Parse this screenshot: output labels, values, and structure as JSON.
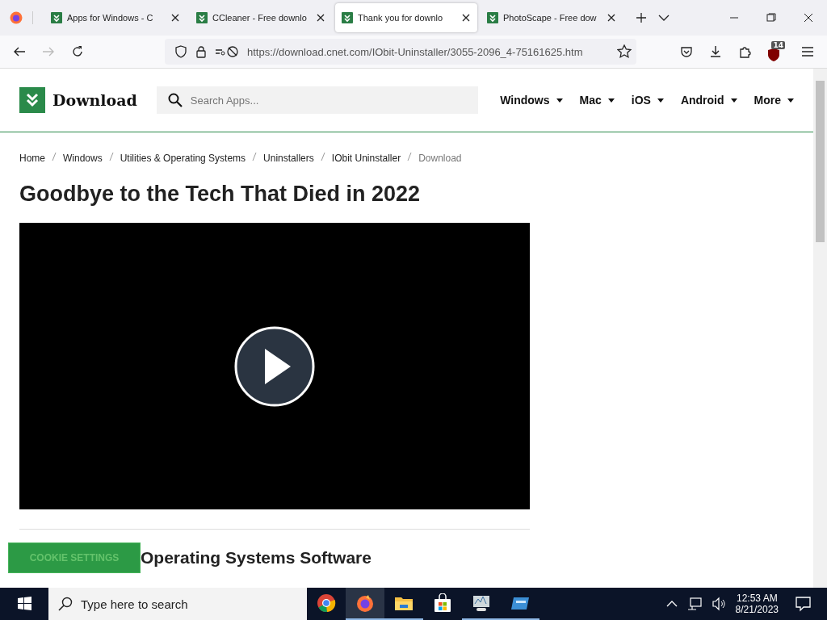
{
  "browser": {
    "tabs": [
      {
        "title": "Apps for Windows - C",
        "selected": false
      },
      {
        "title": "CCleaner - Free downlo",
        "selected": false
      },
      {
        "title": "Thank you for downlo",
        "selected": true
      },
      {
        "title": "PhotoScape - Free dow",
        "selected": false
      }
    ],
    "url": "https://download.cnet.com/IObit-Uninstaller/3055-2096_4-75161625.htm",
    "extension_badge": "14"
  },
  "site": {
    "logo": "Download",
    "search": {
      "placeholder": "Search Apps..."
    },
    "nav": [
      "Windows",
      "Mac",
      "iOS",
      "Android",
      "More"
    ]
  },
  "breadcrumbs": [
    {
      "label": "Home",
      "current": false
    },
    {
      "label": "Windows",
      "current": false
    },
    {
      "label": "Utilities & Operating Systems",
      "current": false
    },
    {
      "label": "Uninstallers",
      "current": false
    },
    {
      "label": "IObit Uninstaller",
      "current": false
    },
    {
      "label": "Download",
      "current": true
    }
  ],
  "headline": "Goodbye to the Tech That Died in 2022",
  "section_heading": "Operating Systems Software",
  "cookie_button": "COOKIE SETTINGS",
  "taskbar": {
    "search_placeholder": "Type here to search",
    "apps": [
      {
        "kind": "chrome",
        "running": false,
        "selected": false
      },
      {
        "kind": "firefox",
        "running": true,
        "selected": true
      },
      {
        "kind": "explorer",
        "running": true,
        "selected": false
      },
      {
        "kind": "store",
        "running": false,
        "selected": false
      },
      {
        "kind": "monitor",
        "running": true,
        "selected": false
      },
      {
        "kind": "console",
        "running": true,
        "selected": false
      }
    ],
    "time": "12:53 AM",
    "date": "8/21/2023"
  }
}
